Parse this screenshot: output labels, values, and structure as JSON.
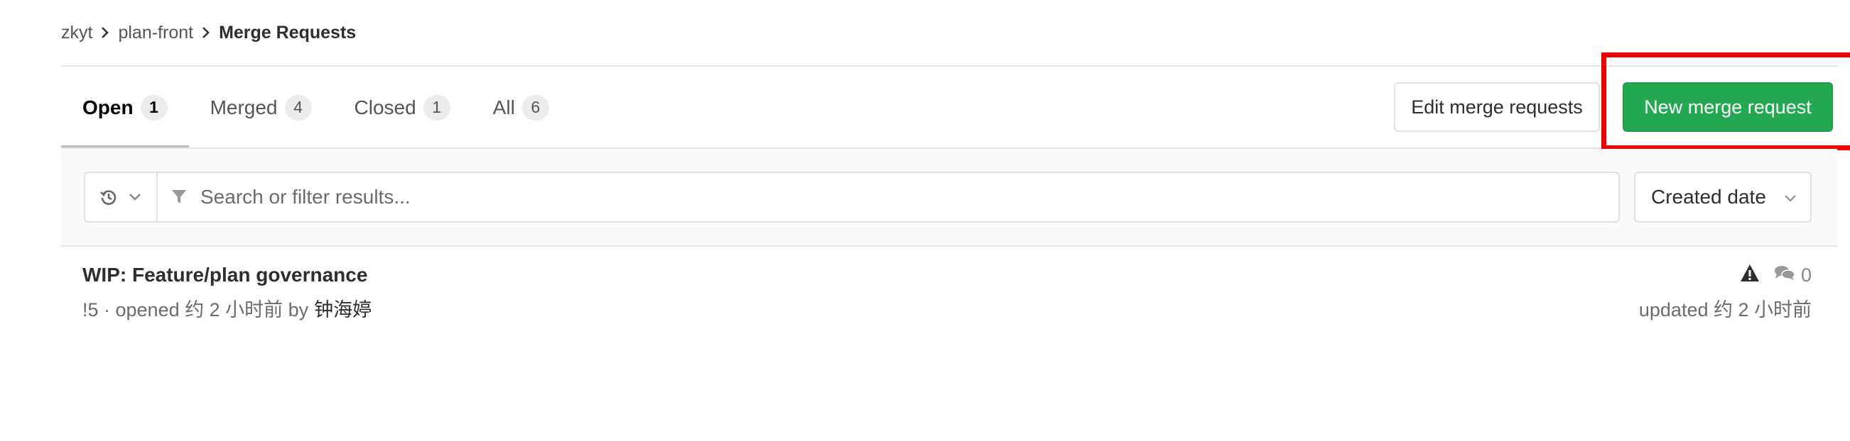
{
  "breadcrumb": {
    "items": [
      "zkyt",
      "plan-front"
    ],
    "current": "Merge Requests"
  },
  "tabs": [
    {
      "label": "Open",
      "count": "1",
      "active": true
    },
    {
      "label": "Merged",
      "count": "4",
      "active": false
    },
    {
      "label": "Closed",
      "count": "1",
      "active": false
    },
    {
      "label": "All",
      "count": "6",
      "active": false
    }
  ],
  "actions": {
    "edit_label": "Edit merge requests",
    "new_label": "New merge request"
  },
  "filter": {
    "placeholder": "Search or filter results...",
    "sort_label": "Created date"
  },
  "merge_requests": [
    {
      "title": "WIP: Feature/plan governance",
      "meta": "!5 · opened 约 2 小时前 by",
      "author": "钟海婷",
      "comments": "0",
      "updated": "updated 约 2 小时前"
    }
  ],
  "colors": {
    "accent_green": "#24a952",
    "highlight_red": "#ee0000"
  },
  "icons": {
    "history": "history-icon",
    "filter": "filter-icon",
    "warning": "warning-icon",
    "comments": "comments-icon",
    "chevron": "chevron-down-icon"
  }
}
